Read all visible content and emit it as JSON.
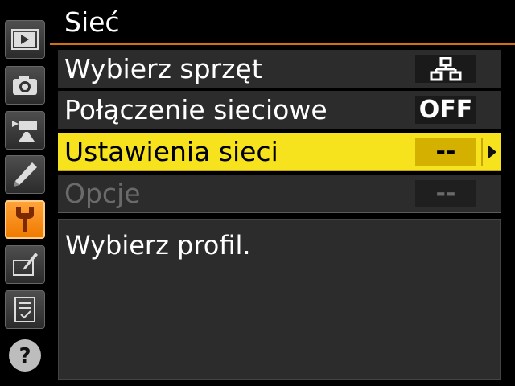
{
  "title": "Sieć",
  "accent_color": "#d36f12",
  "selected_color": "#f7e21e",
  "sidebar": {
    "tabs": [
      {
        "icon": "playback-icon"
      },
      {
        "icon": "camera-icon"
      },
      {
        "icon": "movie-camera-icon"
      },
      {
        "icon": "pencil-icon"
      },
      {
        "icon": "wrench-icon",
        "active": true
      },
      {
        "icon": "retouch-icon"
      },
      {
        "icon": "my-menu-icon"
      },
      {
        "icon": "help-icon"
      }
    ],
    "help_glyph": "?"
  },
  "menu": {
    "items": [
      {
        "label": "Wybierz sprzęt",
        "value_icon": "network-icon"
      },
      {
        "label": "Połączenie sieciowe",
        "value": "OFF"
      },
      {
        "label": "Ustawienia sieci",
        "value": "--",
        "selected": true
      },
      {
        "label": "Opcje",
        "value": "--",
        "disabled": true
      }
    ]
  },
  "help": {
    "text": "Wybierz profil."
  }
}
